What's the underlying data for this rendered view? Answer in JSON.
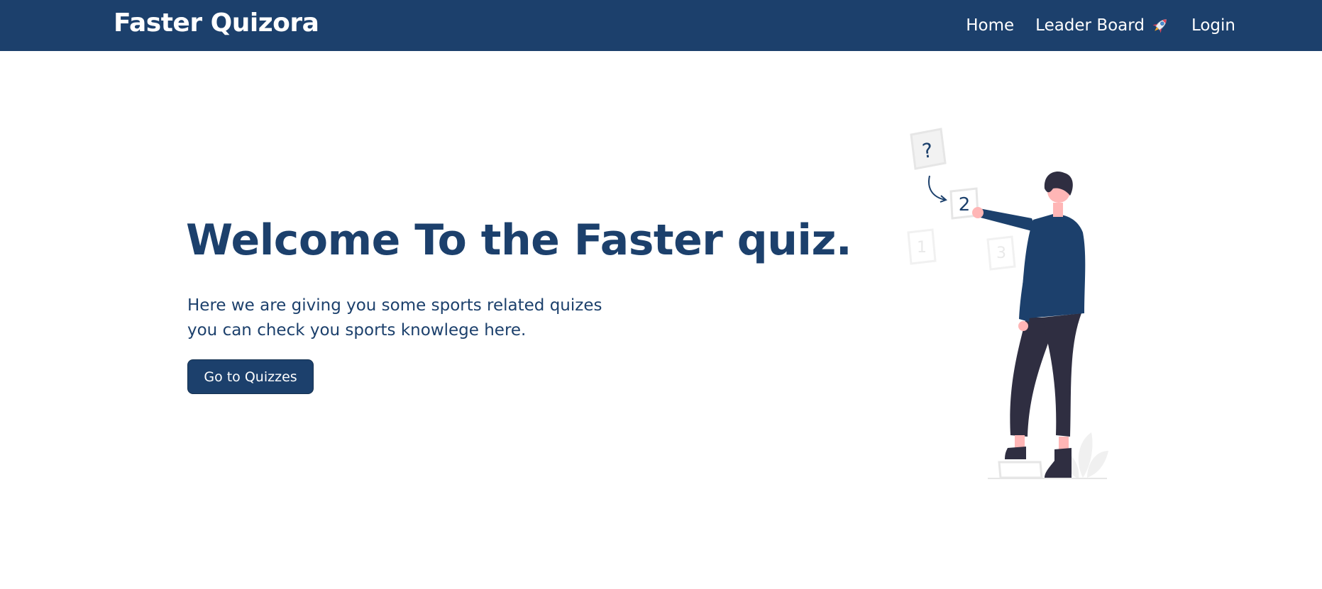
{
  "navbar": {
    "brand": "Faster Quizora",
    "links": [
      {
        "label": "Home"
      },
      {
        "label": "Leader Board",
        "icon": "rocket-icon"
      },
      {
        "label": "Login"
      }
    ]
  },
  "hero": {
    "title": "Welcome To the Faster quiz.",
    "subtitle_line1": "Here we are giving you some sports related quizes",
    "subtitle_line2": "you can check you sports knowlege here.",
    "cta_label": "Go to Quizzes"
  },
  "illustration": {
    "cards": [
      "?",
      "2",
      "1",
      "3"
    ]
  },
  "colors": {
    "primary": "#1c406c",
    "background": "#ffffff",
    "pants": "#2f2e41",
    "skin": "#ffb6b6"
  }
}
